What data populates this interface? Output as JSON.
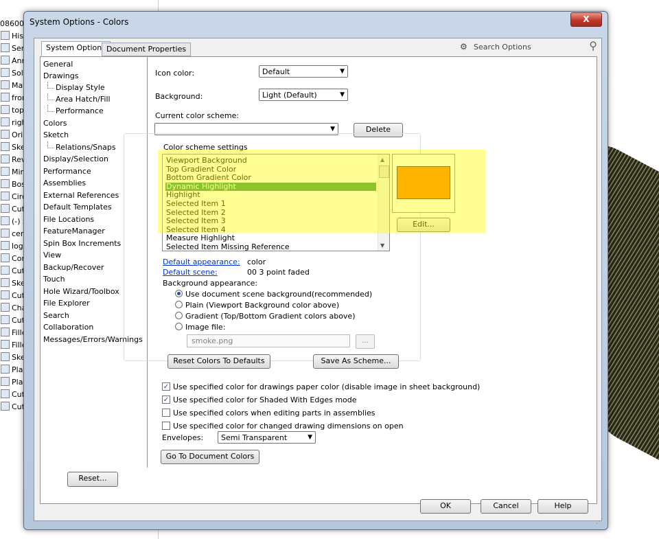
{
  "background": {
    "tree_items": [
      "08600",
      "Hist",
      "Sen",
      "Ann",
      "Soli",
      "Mat",
      "fron",
      "top",
      "righ",
      "Orig",
      "Ske",
      "Rev",
      "Mir",
      "Bos",
      "Circ",
      "Cut",
      "(-) S",
      "cen",
      "logo",
      "Cor",
      "Cut",
      "Ske",
      "Cut",
      "Cha",
      "Cut",
      "Fille",
      "Fille",
      "Ske",
      "Plan",
      "Plan",
      "Cut",
      "Cut"
    ]
  },
  "dialog": {
    "title": "System Options - Colors",
    "close_label": "X",
    "tabs": [
      "System Options",
      "Document Properties"
    ],
    "search_placeholder": "Search Options"
  },
  "nav": {
    "items": [
      "General",
      "Drawings",
      "Display Style",
      "Area Hatch/Fill",
      "Performance",
      "Colors",
      "Sketch",
      "Relations/Snaps",
      "Display/Selection",
      "Performance",
      "Assemblies",
      "External References",
      "Default Templates",
      "File Locations",
      "FeatureManager",
      "Spin Box Increments",
      "View",
      "Backup/Recover",
      "Touch",
      "Hole Wizard/Toolbox",
      "File Explorer",
      "Search",
      "Collaboration",
      "Messages/Errors/Warnings"
    ],
    "selected": "Colors"
  },
  "colors": {
    "icon_color_label": "Icon color:",
    "icon_color_value": "Default",
    "background_label": "Background:",
    "background_value": "Light (Default)",
    "scheme_label": "Current color scheme:",
    "scheme_value": "",
    "delete_label": "Delete",
    "group_title": "Color scheme settings",
    "scheme_items": [
      "Viewport Background",
      "Top Gradient Color",
      "Bottom Gradient Color",
      "Dynamic Highlight",
      "Highlight",
      "Selected Item 1",
      "Selected Item 2",
      "Selected Item 3",
      "Selected Item 4",
      "Measure Highlight",
      "Selected Item Missing Reference"
    ],
    "selected_item": "Dynamic Highlight",
    "preview_color": "#ff8000",
    "edit_label": "Edit...",
    "default_appearance_label": "Default appearance:",
    "default_appearance_value": "color",
    "default_scene_label": "Default scene:",
    "default_scene_value": "00 3 point faded",
    "bg_appearance_label": "Background appearance:",
    "radio_options": [
      "Use document scene background(recommended)",
      "Plain (Viewport Background color above)",
      "Gradient (Top/Bottom Gradient colors above)",
      "Image file:"
    ],
    "radio_selected": 0,
    "image_file_value": "smoke.png",
    "browse_label": "...",
    "reset_colors_label": "Reset Colors To Defaults",
    "save_scheme_label": "Save As Scheme...",
    "checkboxes": [
      {
        "label": "Use specified color for drawings paper color (disable image in sheet background)",
        "checked": true
      },
      {
        "label": "Use specified color for Shaded With Edges mode",
        "checked": true
      },
      {
        "label": "Use specified colors when editing parts in assemblies",
        "checked": false
      },
      {
        "label": "Use specified color for changed drawing dimensions on open",
        "checked": false
      }
    ],
    "envelopes_label": "Envelopes:",
    "envelopes_value": "Semi Transparent",
    "goto_doc_colors_label": "Go To Document Colors",
    "highlight_color": "#ffff00"
  },
  "footer": {
    "reset_label": "Reset...",
    "ok_label": "OK",
    "cancel_label": "Cancel",
    "help_label": "Help"
  }
}
